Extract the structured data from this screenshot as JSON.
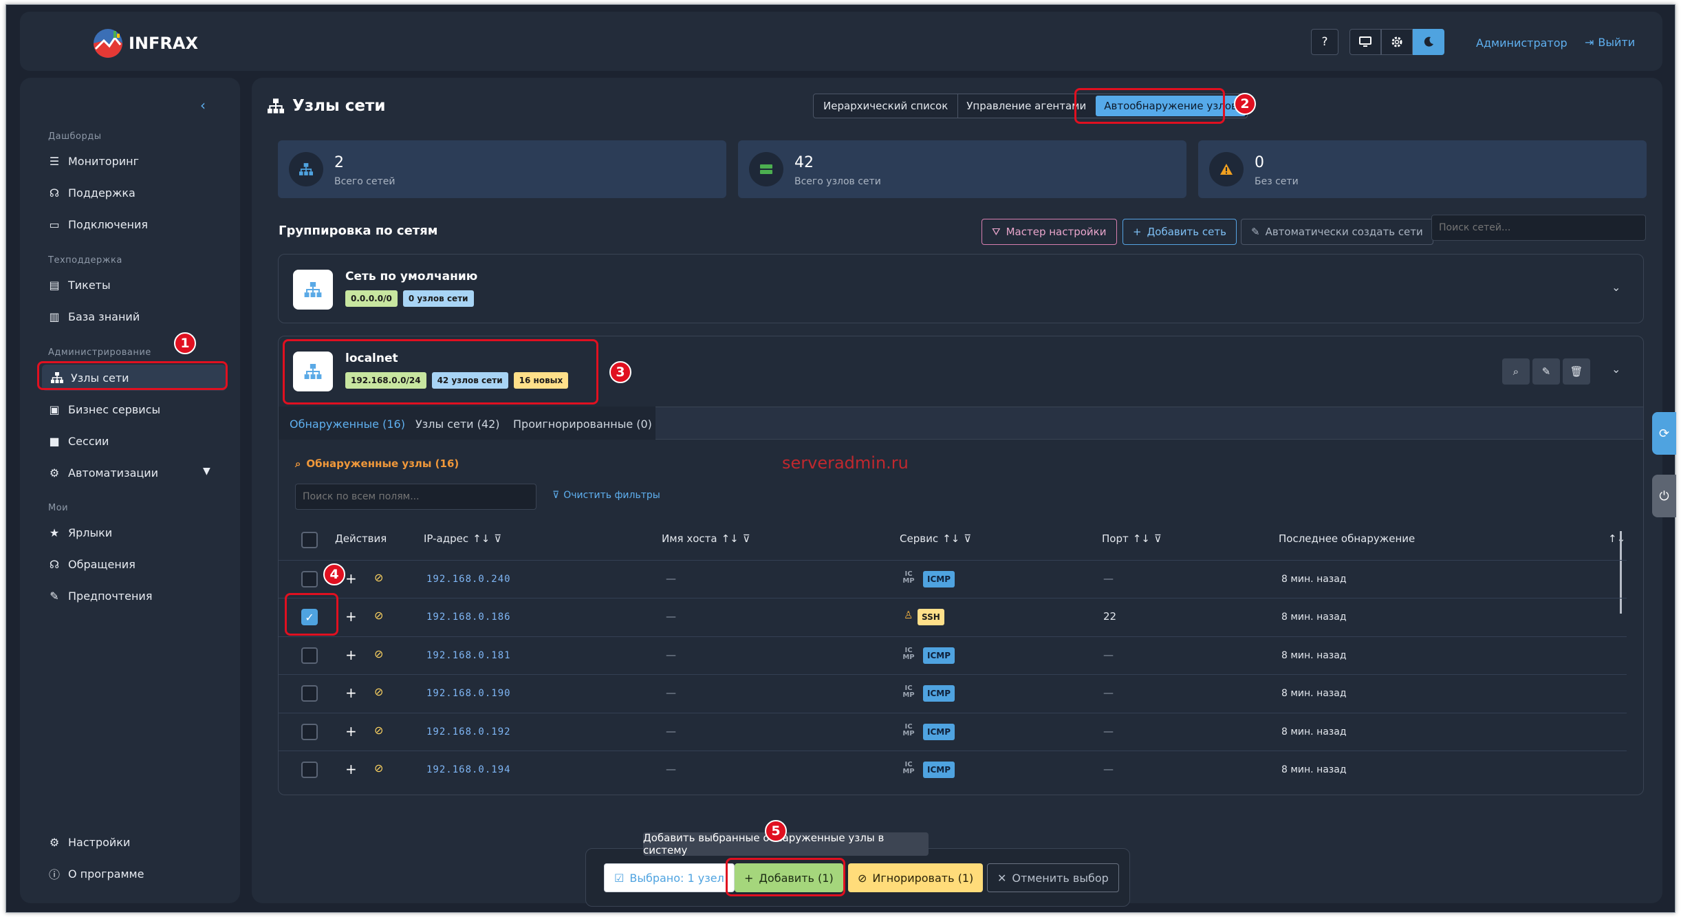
{
  "app": {
    "name": "INFRAX"
  },
  "header": {
    "help": "?",
    "user": "Администратор",
    "logout": "Выйти"
  },
  "sidebar": {
    "collapse": "‹",
    "sections": [
      {
        "title": "Дашборды",
        "items": [
          "Мониторинг",
          "Поддержка",
          "Подключения"
        ]
      },
      {
        "title": "Техподдержка",
        "items": [
          "Тикеты",
          "База знаний"
        ]
      },
      {
        "title": "Администрирование",
        "items": [
          "Узлы сети",
          "Бизнес сервисы",
          "Сессии",
          "Автоматизации"
        ]
      },
      {
        "title": "Мои",
        "items": [
          "Ярлыки",
          "Обращения",
          "Предпочтения"
        ]
      }
    ],
    "bottom": [
      "Настройки",
      "О программе"
    ]
  },
  "page": {
    "title": "Узлы сети",
    "tabs": [
      "Иерархический список",
      "Управление агентами",
      "Автообнаружение узлов"
    ]
  },
  "stats": [
    {
      "value": "2",
      "label": "Всего сетей"
    },
    {
      "value": "42",
      "label": "Всего узлов сети"
    },
    {
      "value": "0",
      "label": "Без сети"
    }
  ],
  "grouping": {
    "title": "Группировка по сетям",
    "wizard": "Мастер настройки",
    "add": "Добавить сеть",
    "auto": "Автоматически создать сети",
    "search_placeholder": "Поиск сетей..."
  },
  "networks": [
    {
      "name": "Сеть по умолчанию",
      "badges": [
        "0.0.0.0/0",
        "0 узлов сети"
      ]
    },
    {
      "name": "localnet",
      "badges": [
        "192.168.0.0/24",
        "42 узлов сети",
        "16 новых"
      ]
    }
  ],
  "subtabs": [
    "Обнаруженные (16)",
    "Узлы сети (42)",
    "Проигнорированные (0)"
  ],
  "discovered": {
    "title": "Обнаруженные узлы (16)",
    "search_placeholder": "Поиск по всем полям...",
    "clear": "Очистить фильтры",
    "watermark": "serveradmin.ru"
  },
  "table": {
    "headers": {
      "actions": "Действия",
      "ip": "IP-адрес",
      "host": "Имя хоста",
      "service": "Сервис",
      "port": "Порт",
      "last": "Последнее обнаружение"
    },
    "rows": [
      {
        "ip": "192.168.0.240",
        "host": "—",
        "service": "ICMP",
        "port": "—",
        "last": "8 мин. назад"
      },
      {
        "ip": "192.168.0.186",
        "host": "—",
        "service": "SSH",
        "port": "22",
        "last": "8 мин. назад"
      },
      {
        "ip": "192.168.0.181",
        "host": "—",
        "service": "ICMP",
        "port": "—",
        "last": "8 мин. назад"
      },
      {
        "ip": "192.168.0.190",
        "host": "—",
        "service": "ICMP",
        "port": "—",
        "last": "8 мин. назад"
      },
      {
        "ip": "192.168.0.192",
        "host": "—",
        "service": "ICMP",
        "port": "—",
        "last": "8 мин. назад"
      },
      {
        "ip": "192.168.0.194",
        "host": "—",
        "service": "ICMP",
        "port": "—",
        "last": "8 мин. назад"
      }
    ],
    "icmp_icon": "IC MP"
  },
  "bottombar": {
    "tooltip": "Добавить выбранные обнаруженные узлы в систему",
    "selected": "Выбрано: 1 узел",
    "add": "Добавить (1)",
    "ignore": "Игнорировать (1)",
    "cancel": "Отменить выбор"
  },
  "annotations": [
    "1",
    "2",
    "3",
    "4",
    "5"
  ],
  "colors": {
    "accent": "#4fa3e0",
    "annotation": "#e01020",
    "badge_green": "#c8e6a0",
    "badge_blue": "#a8d4f5",
    "badge_yellow": "#ffe08a"
  }
}
